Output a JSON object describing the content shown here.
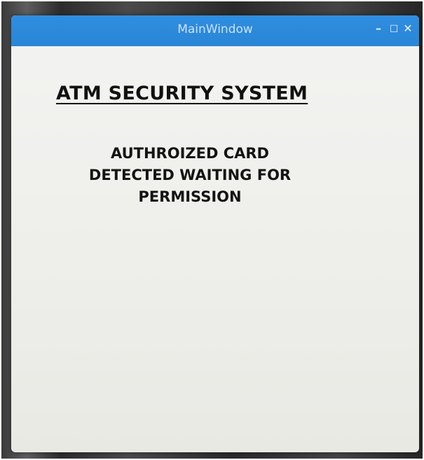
{
  "window": {
    "title": "MainWindow",
    "controls": {
      "minimize_glyph": "–",
      "maximize_glyph": "□",
      "close_glyph": "✕"
    }
  },
  "content": {
    "heading": "ATM SECURITY SYSTEM",
    "message_lines": [
      "AUTHROIZED CARD",
      "DETECTED WAITING FOR",
      "PERMISSION"
    ]
  },
  "colors": {
    "titlebar": "#2f8ee0",
    "window_bg": "#efefec",
    "text": "#111111"
  }
}
